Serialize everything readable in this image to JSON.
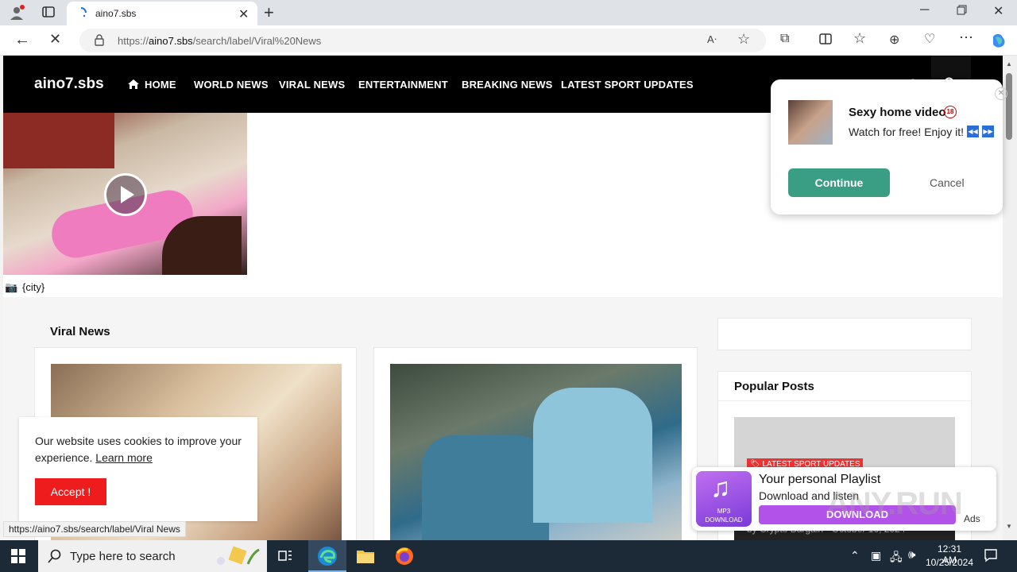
{
  "browser": {
    "tab_title": "aino7.sbs",
    "url_prefix": "https://",
    "url_host": "aino7.sbs",
    "url_path": "/search/label/Viral%20News",
    "status_url": "https://aino7.sbs/search/label/Viral News"
  },
  "site": {
    "logo": "aino7.sbs",
    "nav": [
      "HOME",
      "WORLD NEWS",
      "VIRAL NEWS",
      "ENTERTAINMENT",
      "BREAKING NEWS",
      "LATEST SPORT UPDATES"
    ],
    "city_caption": "{city}",
    "section_title": "Viral News",
    "popular_title": "Popular Posts",
    "popular_badge": "LATEST SPORT UPDATES",
    "popular_meta": "by Crypto Bargain - October 16, 2024"
  },
  "popup": {
    "title": "Sexy home video",
    "subtitle": "Watch for free! Enjoy it!",
    "continue": "Continue",
    "cancel": "Cancel"
  },
  "cookie": {
    "text": "Our website uses cookies to improve your experience.",
    "link": "Learn more",
    "accept": "Accept !"
  },
  "ad": {
    "title": "Your personal Playlist",
    "subtitle": "Download and listen",
    "button": "DOWNLOAD",
    "icon_text_1": "MP3",
    "icon_text_2": "DOWNLOAD",
    "tag": "Ads"
  },
  "watermark": "ANY.RUN",
  "taskbar": {
    "search_placeholder": "Type here to search",
    "time": "12:31 AM",
    "date": "10/25/2024"
  },
  "colors": {
    "accent_red": "#ee2222",
    "continue_green": "#3a9e85",
    "ad_purple": "#b352e8"
  }
}
